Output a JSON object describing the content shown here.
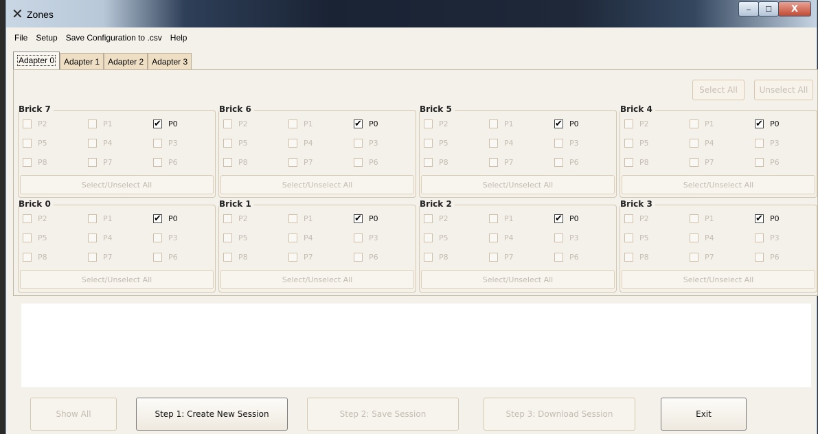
{
  "window": {
    "title": "Zones",
    "app_icon": "x-logo-icon",
    "minimize": "‒",
    "maximize": "☐",
    "close": "X"
  },
  "menu": [
    "File",
    "Setup",
    "Save Configuration to .csv",
    "Help"
  ],
  "tabs": [
    "Adapter 0",
    "Adapter 1",
    "Adapter 2",
    "Adapter 3"
  ],
  "active_tab": "Adapter 0",
  "panel": {
    "select_all": "Select All",
    "unselect_all": "Unselect All",
    "brick_select_label": "Select/Unselect All",
    "bricks": [
      {
        "title": "Brick 7",
        "ports": [
          [
            "P2",
            "P1",
            "P0"
          ],
          [
            "P5",
            "P4",
            "P3"
          ],
          [
            "P8",
            "P7",
            "P6"
          ]
        ],
        "checked": [
          "P0"
        ]
      },
      {
        "title": "Brick 6",
        "ports": [
          [
            "P2",
            "P1",
            "P0"
          ],
          [
            "P5",
            "P4",
            "P3"
          ],
          [
            "P8",
            "P7",
            "P6"
          ]
        ],
        "checked": [
          "P0"
        ]
      },
      {
        "title": "Brick 5",
        "ports": [
          [
            "P2",
            "P1",
            "P0"
          ],
          [
            "P5",
            "P4",
            "P3"
          ],
          [
            "P8",
            "P7",
            "P6"
          ]
        ],
        "checked": [
          "P0"
        ]
      },
      {
        "title": "Brick 4",
        "ports": [
          [
            "P2",
            "P1",
            "P0"
          ],
          [
            "P5",
            "P4",
            "P3"
          ],
          [
            "P8",
            "P7",
            "P6"
          ]
        ],
        "checked": [
          "P0"
        ]
      },
      {
        "title": "Brick 0",
        "ports": [
          [
            "P2",
            "P1",
            "P0"
          ],
          [
            "P5",
            "P4",
            "P3"
          ],
          [
            "P8",
            "P7",
            "P6"
          ]
        ],
        "checked": [
          "P0"
        ]
      },
      {
        "title": "Brick 1",
        "ports": [
          [
            "P2",
            "P1",
            "P0"
          ],
          [
            "P5",
            "P4",
            "P3"
          ],
          [
            "P8",
            "P7",
            "P6"
          ]
        ],
        "checked": [
          "P0"
        ]
      },
      {
        "title": "Brick 2",
        "ports": [
          [
            "P2",
            "P1",
            "P0"
          ],
          [
            "P5",
            "P4",
            "P3"
          ],
          [
            "P8",
            "P7",
            "P6"
          ]
        ],
        "checked": [
          "P0"
        ]
      },
      {
        "title": "Brick 3",
        "ports": [
          [
            "P2",
            "P1",
            "P0"
          ],
          [
            "P5",
            "P4",
            "P3"
          ],
          [
            "P8",
            "P7",
            "P6"
          ]
        ],
        "checked": [
          "P0"
        ]
      }
    ]
  },
  "log_text": "",
  "bottom_buttons": [
    {
      "label": "Show All",
      "enabled": false
    },
    {
      "label": "Step 1: Create New Session",
      "enabled": true
    },
    {
      "label": "Step 2: Save Session",
      "enabled": false
    },
    {
      "label": "Step 3: Download Session",
      "enabled": false
    },
    {
      "label": "Exit",
      "enabled": true
    }
  ]
}
